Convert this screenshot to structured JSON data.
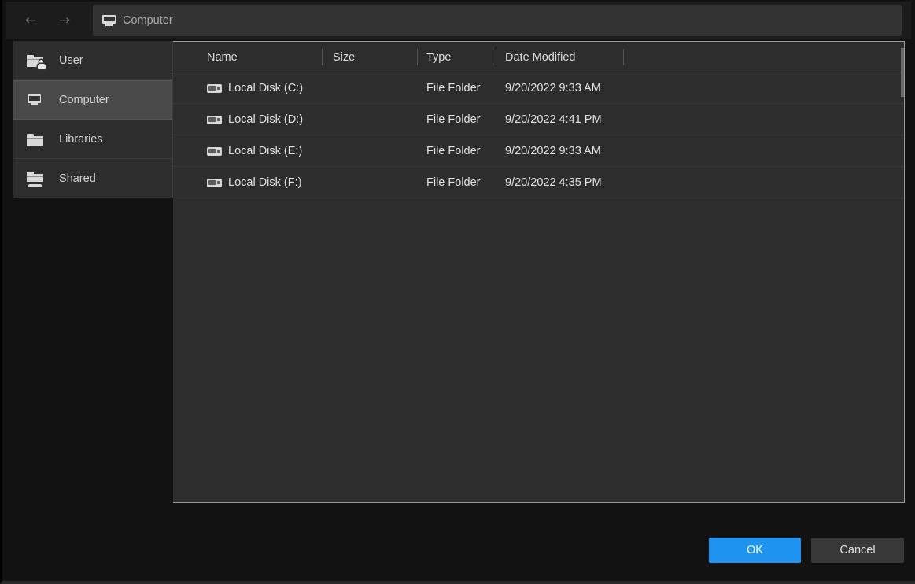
{
  "window": {
    "background": "#121212",
    "panel_bg": "#2d2d2d",
    "accent": "#1e93ef"
  },
  "toolbar": {
    "back_icon": "arrow-left-icon",
    "back_glyph": "←",
    "forward_icon": "arrow-right-icon",
    "forward_glyph": "→",
    "path": {
      "icon": "computer-monitor-icon",
      "label": "Computer",
      "placeholder": "Computer"
    }
  },
  "sidebar": {
    "items": [
      {
        "label": "User",
        "icon": "user-folder-icon",
        "selected": false
      },
      {
        "label": "Computer",
        "icon": "computer-monitor-icon",
        "selected": true
      },
      {
        "label": "Libraries",
        "icon": "folder-icon",
        "selected": false
      },
      {
        "label": "Shared",
        "icon": "shared-folder-icon",
        "selected": false
      }
    ]
  },
  "file_list": {
    "columns": [
      {
        "key": "name",
        "label": "Name"
      },
      {
        "key": "size",
        "label": "Size"
      },
      {
        "key": "type",
        "label": "Type"
      },
      {
        "key": "date",
        "label": "Date Modified"
      }
    ],
    "rows": [
      {
        "icon": "disk-drive-icon",
        "name": "Local Disk (C:)",
        "size": "",
        "type": "File Folder",
        "date": "9/20/2022 9:33 AM"
      },
      {
        "icon": "disk-drive-icon",
        "name": "Local Disk (D:)",
        "size": "",
        "type": "File Folder",
        "date": "9/20/2022 4:41 PM"
      },
      {
        "icon": "disk-drive-icon",
        "name": "Local Disk (E:)",
        "size": "",
        "type": "File Folder",
        "date": "9/20/2022 9:33 AM"
      },
      {
        "icon": "disk-drive-icon",
        "name": "Local Disk (F:)",
        "size": "",
        "type": "File Folder",
        "date": "9/20/2022 4:35 PM"
      }
    ]
  },
  "footer": {
    "ok_label": "OK",
    "cancel_label": "Cancel"
  }
}
